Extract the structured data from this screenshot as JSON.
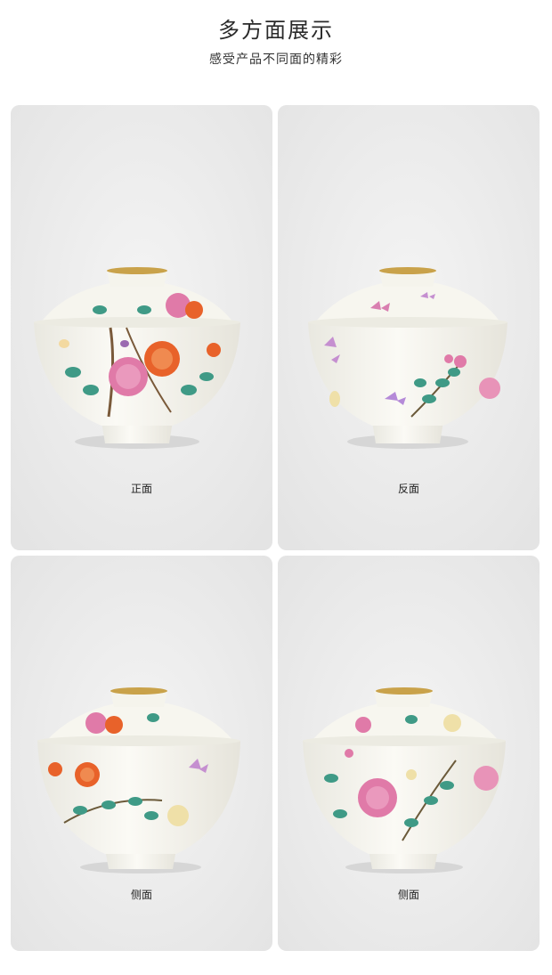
{
  "header": {
    "title": "多方面展示",
    "subtitle": "感受产品不同面的精彩"
  },
  "views": [
    {
      "label": "正面",
      "motif": "peony-chrysanthemum-front"
    },
    {
      "label": "反面",
      "motif": "butterfly-back"
    },
    {
      "label": "侧面",
      "motif": "chrysanthemum-side"
    },
    {
      "label": "侧面",
      "motif": "peony-side"
    }
  ],
  "colors": {
    "card_background": "#ececec",
    "porcelain": "#f7f6f0",
    "gold_rim": "#c9a24a",
    "pink": "#e0709a",
    "orange": "#e8622a",
    "leaf": "#3f9a86"
  }
}
